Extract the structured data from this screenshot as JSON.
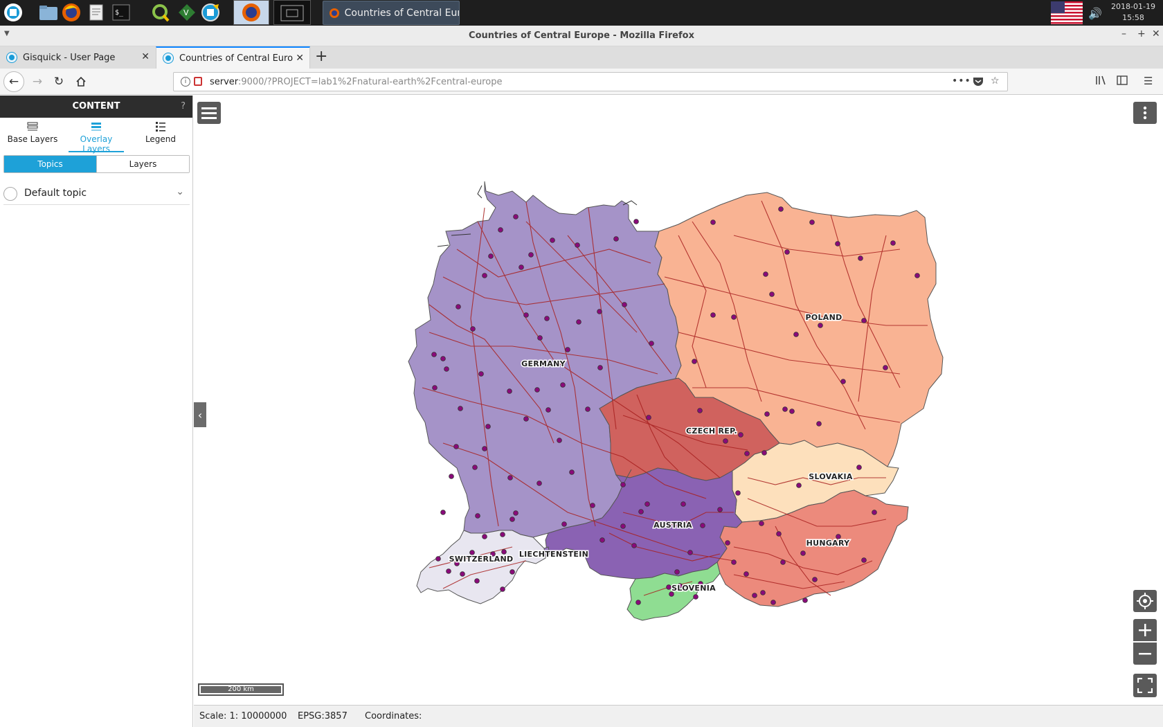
{
  "taskbar": {
    "task_title": "Countries of Central Eur...",
    "clock_date": "2018-01-19",
    "clock_time": "15:58"
  },
  "window": {
    "title": "Countries of Central Europe - Mozilla Firefox"
  },
  "tabs": [
    {
      "label": "Gisquick - User Page",
      "active": false
    },
    {
      "label": "Countries of Central Euro",
      "active": true
    }
  ],
  "navbar": {
    "url_host": "server",
    "url_rest": ":9000/?PROJECT=lab1%2Fnatural-earth%2Fcentral-europe"
  },
  "sidebar": {
    "header": "CONTENT",
    "help": "?",
    "tabs": [
      {
        "label": "Base Layers",
        "icon": "stack-icon"
      },
      {
        "label": "Overlay Layers",
        "icon": "stack-icon"
      },
      {
        "label": "Legend",
        "icon": "list-icon"
      }
    ],
    "segment": {
      "topics": "Topics",
      "layers": "Layers"
    },
    "topic": "Default topic"
  },
  "map": {
    "countries": [
      "GERMANY",
      "POLAND",
      "CZECH REP.",
      "SLOVAKIA",
      "AUSTRIA",
      "HUNGARY",
      "SWITZERLAND",
      "LIECHTENSTEIN",
      "SLOVENIA"
    ],
    "colors": {
      "germany": "#a593c8",
      "poland": "#f9b393",
      "czech": "#d0625e",
      "slovakia": "#fde0bc",
      "austria": "#8a62b3",
      "hungary": "#ec8a7c",
      "switzerland": "#e8e6f0",
      "slovenia": "#8fdd92",
      "roads": "#a8201f",
      "cities": "#8a0a7a"
    },
    "scalebar": "200 km"
  },
  "status": {
    "scale": "Scale: 1: 10000000",
    "epsg": "EPSG:3857",
    "coordinates": "Coordinates:"
  }
}
